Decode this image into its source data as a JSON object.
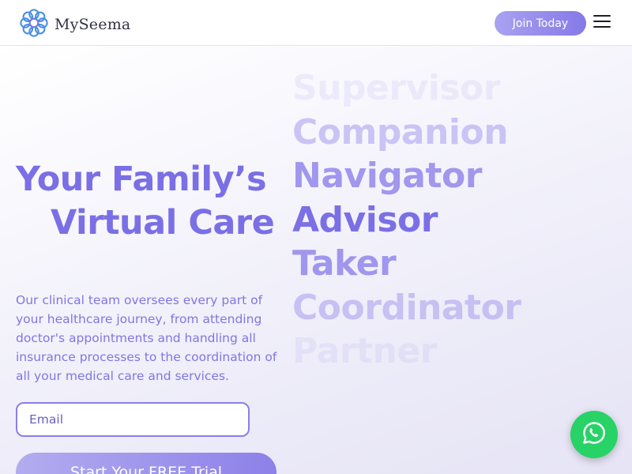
{
  "header": {
    "brand": "MySeema",
    "join_label": "Join Today",
    "logo_icon": "flower-logo-icon",
    "menu_icon": "hamburger-menu-icon"
  },
  "hero": {
    "headline_line1": "Your Family’s",
    "headline_line2": "Virtual Care",
    "roles": [
      "Supervisor",
      "Companion",
      "Navigator",
      "Advisor",
      "Taker",
      "Coordinator",
      "Partner"
    ],
    "description": "Our clinical team oversees every part of your healthcare journey, from attending doctor's appointments and handling all insurance processes to the coordination of all your medical care and services.",
    "email_placeholder": "Email",
    "cta_label": "Start Your FREE Trial"
  },
  "floating": {
    "chat_icon": "whatsapp-icon",
    "chat_color": "#27d366"
  },
  "colors": {
    "accent": "#7b6fe6",
    "button_gradient_start": "#a9a2f0",
    "button_gradient_end": "#8579e8",
    "logo_blue": "#4a90e2"
  }
}
